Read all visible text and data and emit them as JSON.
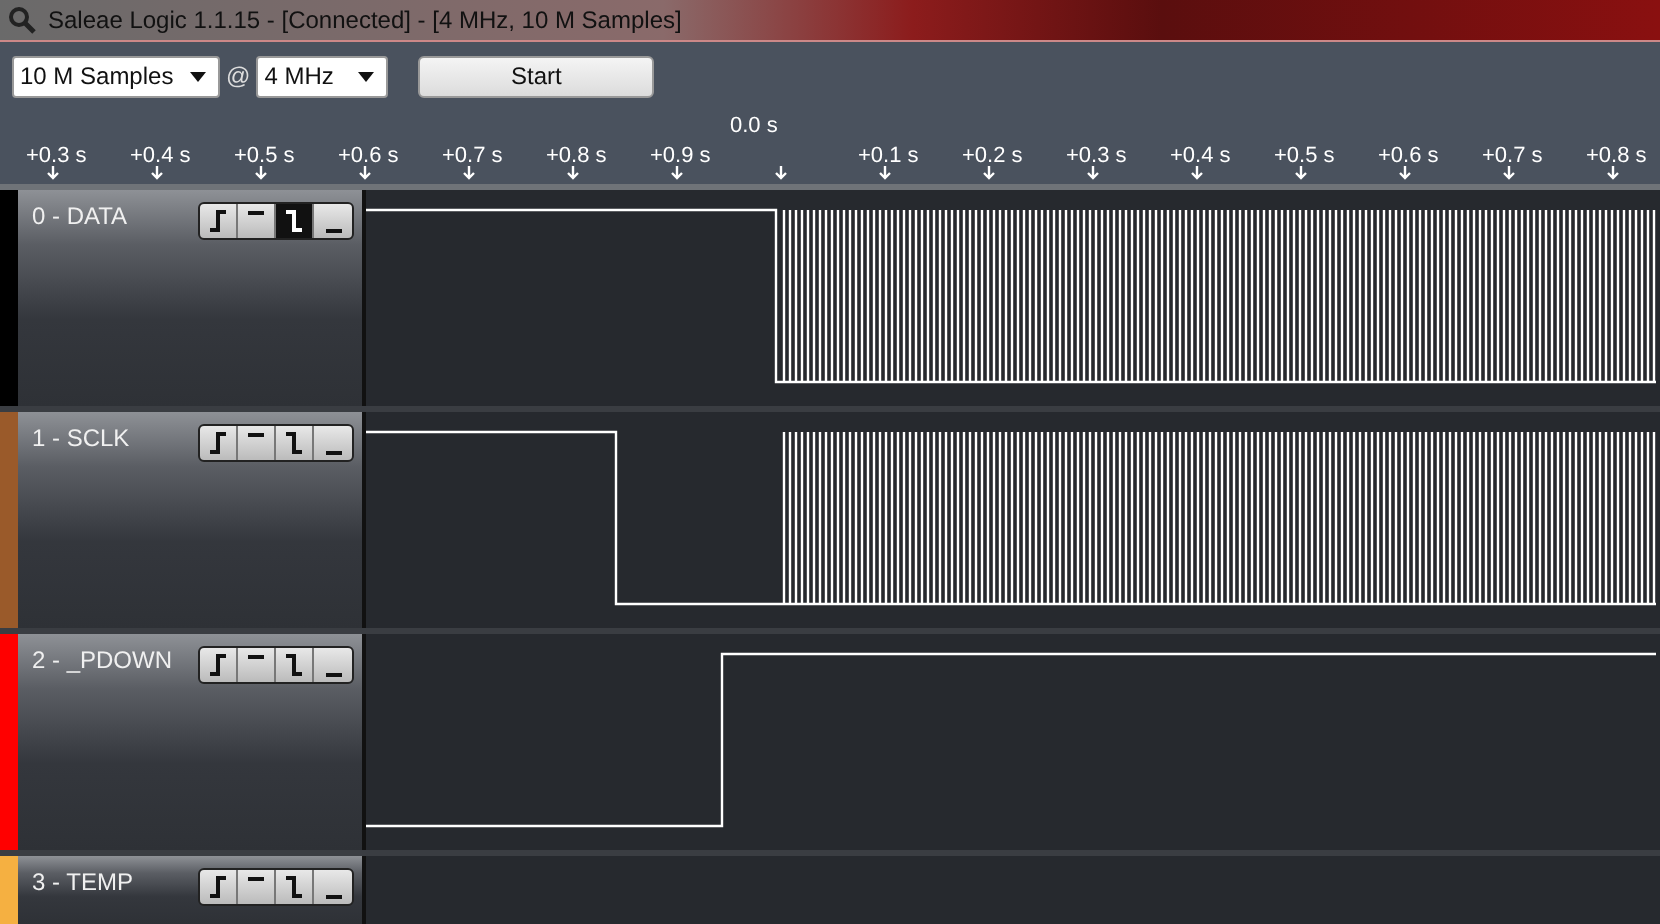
{
  "window": {
    "title": "Saleae Logic 1.1.15 - [Connected] - [4 MHz, 10 M Samples]"
  },
  "toolbar": {
    "samples": "10 M Samples",
    "at": "@",
    "rate": "4 MHz",
    "start": "Start"
  },
  "ruler": {
    "ticks": [
      {
        "kind": "offset",
        "label": "+0.3 s"
      },
      {
        "kind": "offset",
        "label": "+0.4 s"
      },
      {
        "kind": "offset",
        "label": "+0.5 s"
      },
      {
        "kind": "offset",
        "label": "+0.6 s"
      },
      {
        "kind": "offset",
        "label": "+0.7 s"
      },
      {
        "kind": "offset",
        "label": "+0.8 s"
      },
      {
        "kind": "offset",
        "label": "+0.9 s"
      },
      {
        "kind": "center",
        "label": "0.0 s"
      },
      {
        "kind": "offset",
        "label": "+0.1 s"
      },
      {
        "kind": "offset",
        "label": "+0.2 s"
      },
      {
        "kind": "offset",
        "label": "+0.3 s"
      },
      {
        "kind": "offset",
        "label": "+0.4 s"
      },
      {
        "kind": "offset",
        "label": "+0.5 s"
      },
      {
        "kind": "offset",
        "label": "+0.6 s"
      },
      {
        "kind": "offset",
        "label": "+0.7 s"
      },
      {
        "kind": "offset",
        "label": "+0.8 s"
      }
    ]
  },
  "channels": [
    {
      "name": "0 - DATA",
      "color": "#000000",
      "kind": "high-then-burst",
      "triggers": [
        {
          "kind": "rising",
          "selected": false
        },
        {
          "kind": "high",
          "selected": false
        },
        {
          "kind": "falling",
          "selected": true
        },
        {
          "kind": "low",
          "selected": false
        }
      ]
    },
    {
      "name": "1 - SCLK",
      "color": "#9a5a2a",
      "kind": "high-low-burst",
      "triggers": [
        {
          "kind": "rising",
          "selected": false
        },
        {
          "kind": "high",
          "selected": false
        },
        {
          "kind": "falling",
          "selected": false
        },
        {
          "kind": "low",
          "selected": false
        }
      ]
    },
    {
      "name": "2 - _PDOWN",
      "color": "#ff0000",
      "kind": "low-then-high",
      "triggers": [
        {
          "kind": "rising",
          "selected": false
        },
        {
          "kind": "high",
          "selected": false
        },
        {
          "kind": "falling",
          "selected": false
        },
        {
          "kind": "low",
          "selected": false
        }
      ]
    },
    {
      "name": "3 - TEMP",
      "color": "#f5b041",
      "triggers": [
        {
          "kind": "rising",
          "selected": false
        },
        {
          "kind": "high",
          "selected": false
        },
        {
          "kind": "falling",
          "selected": false
        },
        {
          "kind": "low",
          "selected": false
        }
      ]
    }
  ]
}
